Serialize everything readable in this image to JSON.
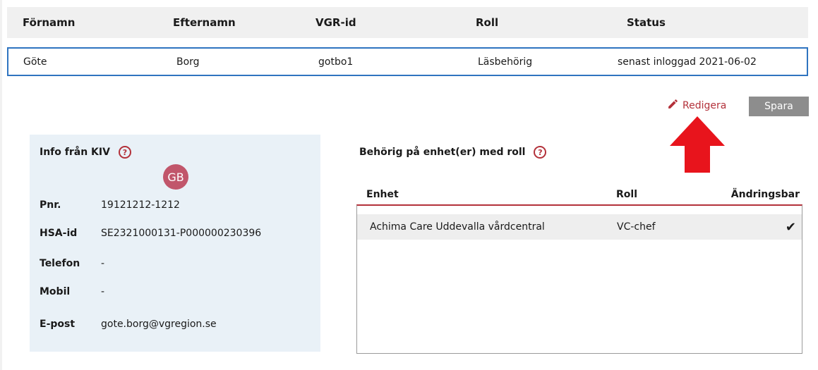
{
  "table": {
    "headers": [
      "Förnamn",
      "Efternamn",
      "VGR-id",
      "Roll",
      "Status"
    ],
    "selected_row": [
      "Göte",
      "Borg",
      "gotbo1",
      "Läsbehörig",
      "senast inloggad 2021-06-02"
    ]
  },
  "actions": {
    "edit_label": "Redigera",
    "save_label": "Spara"
  },
  "kiv": {
    "title": "Info från KIV",
    "avatar_initials": "GB",
    "fields": [
      {
        "label": "Pnr.",
        "value": "19121212-1212"
      },
      {
        "label": "HSA-id",
        "value": "SE2321000131-P000000230396"
      },
      {
        "label": "Telefon",
        "value": "-"
      },
      {
        "label": "Mobil",
        "value": "-"
      },
      {
        "label": "E-post",
        "value": "gote.borg@vgregion.se"
      }
    ]
  },
  "authorization": {
    "title": "Behörig på enhet(er) med roll",
    "headers": [
      "Enhet",
      "Roll",
      "Ändringsbar"
    ],
    "rows": [
      {
        "enhet": "Achima Care Uddevalla vårdcentral",
        "roll": "VC-chef",
        "andringsbar": "✔"
      }
    ]
  },
  "help_glyph": "?",
  "icons": {
    "edit": "pencil-icon",
    "help": "question-circle-icon",
    "check": "checkmark-icon",
    "annotation": "red-up-arrow"
  },
  "colors": {
    "accent_red": "#b3313a",
    "selection_blue": "#2f74c0",
    "panel_bg": "#e9f1f7",
    "avatar_bg": "#c1566b",
    "save_button_bg": "#8d8d8d",
    "annotation_arrow": "#e8141c"
  }
}
